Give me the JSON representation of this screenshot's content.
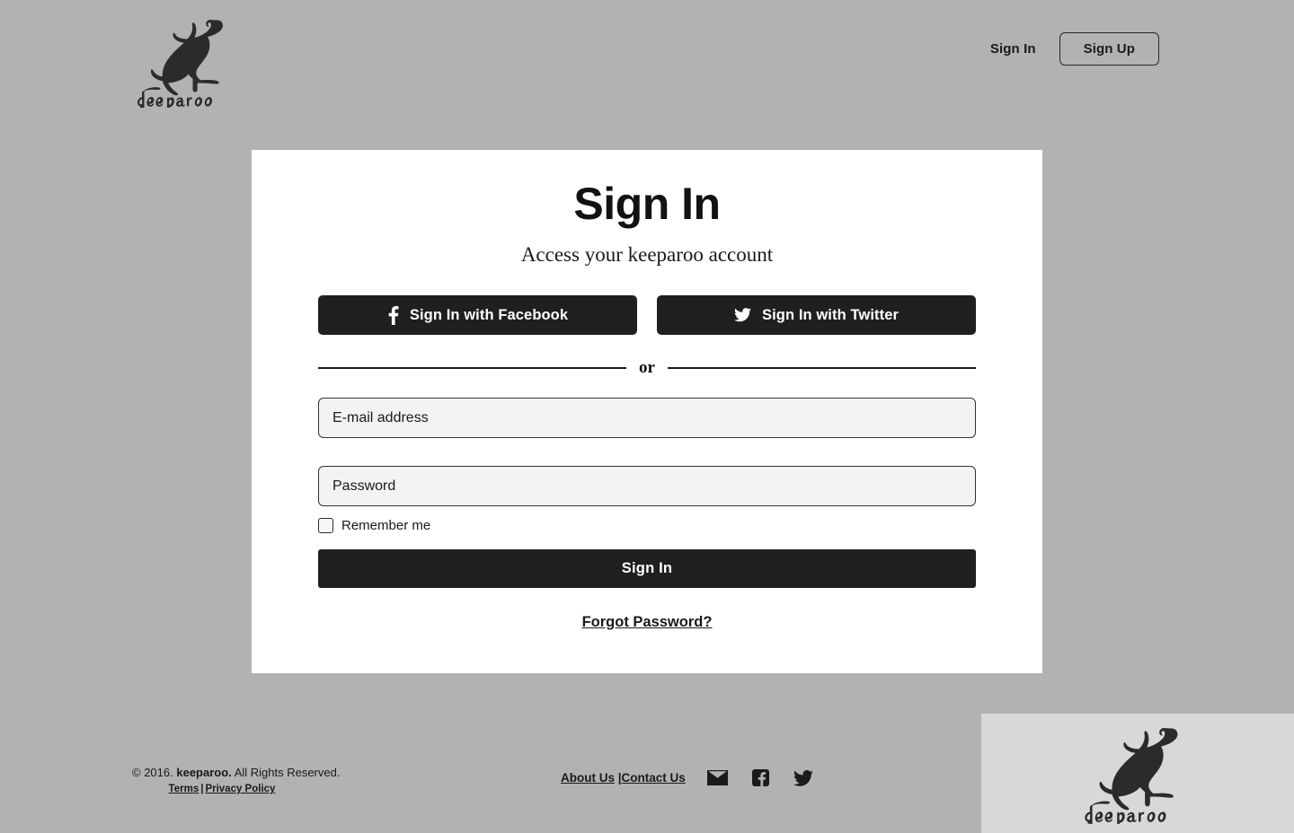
{
  "brand": {
    "name": "keeparoo",
    "logo_icon": "kangaroo-logo"
  },
  "header": {
    "sign_in_label": "Sign In",
    "sign_up_label": "Sign Up"
  },
  "card": {
    "title": "Sign In",
    "subtitle": "Access your keeparoo account",
    "social": {
      "facebook_label": "Sign In with Facebook",
      "facebook_icon": "facebook-icon",
      "twitter_label": "Sign In with Twitter",
      "twitter_icon": "twitter-icon"
    },
    "divider_text": "or",
    "email": {
      "placeholder": "E-mail address",
      "value": ""
    },
    "password": {
      "placeholder": "Password",
      "value": ""
    },
    "remember_me_label": "Remember me",
    "remember_me_checked": false,
    "submit_label": "Sign In",
    "forgot_label": "Forgot Password?"
  },
  "footer": {
    "copyright_prefix": "© 2016.",
    "copyright_brand": "keeparoo.",
    "copyright_suffix": "All Rights Reserved.",
    "terms_label": "Terms",
    "legal_separator": "|",
    "privacy_label": "Privacy Policy",
    "about_label": "About Us",
    "nav_separator": "|",
    "contact_label": "Contact Us",
    "social_icons": [
      "email-icon",
      "facebook-icon",
      "twitter-icon"
    ]
  },
  "colors": {
    "page_background": "#b2b2b2",
    "card_background": "#ffffff",
    "button_dark": "#1f1f1f",
    "input_background": "#f3f3f3",
    "corner_panel_background": "#d8d8d8",
    "text": "#1a1a1a"
  }
}
